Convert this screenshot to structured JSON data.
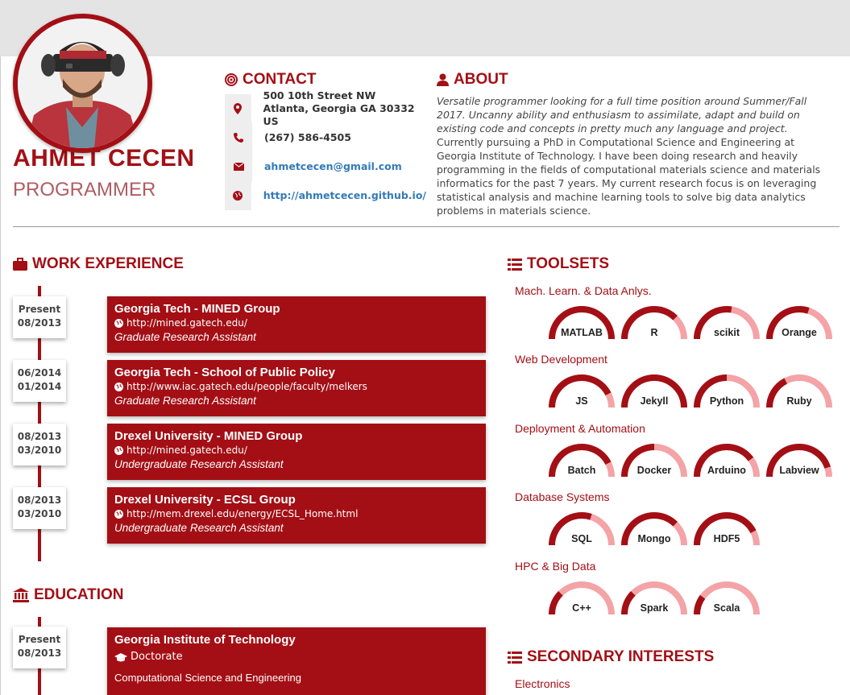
{
  "profile": {
    "name": "AHMET CECEN",
    "title": "PROGRAMMER"
  },
  "contact": {
    "heading": "CONTACT",
    "address_line1": "500 10th Street NW",
    "address_line2": "Atlanta, Georgia GA 30332 US",
    "phone": "(267) 586-4505",
    "email": "ahmetcecen@gmail.com",
    "website": "http://ahmetcecen.github.io/"
  },
  "about": {
    "heading": "ABOUT",
    "intro": "Versatile programmer looking for a full time position around Summer/Fall 2017. Uncanny ability and enthusiasm to assimilate, adapt and build on existing code and concepts in pretty much any language and project.",
    "body": "Currently pursuing a PhD in Computational Science and Engineering at Georgia Institute of Technology. I have been doing research and heavily programming in the fields of computational materials science and materials informatics for the past 7 years. My current research focus is on leveraging statistical analysis and machine learning tools to solve big data analytics problems in materials science."
  },
  "work": {
    "heading": "WORK EXPERIENCE",
    "items": [
      {
        "date_end": "Present",
        "date_start": "08/2013",
        "org": "Georgia Tech - MINED Group",
        "url": "http://mined.gatech.edu/",
        "role": "Graduate Research Assistant"
      },
      {
        "date_end": "06/2014",
        "date_start": "01/2014",
        "org": "Georgia Tech - School of Public Policy",
        "url": "http://www.iac.gatech.edu/people/faculty/melkers",
        "role": "Graduate Research Assistant"
      },
      {
        "date_end": "08/2013",
        "date_start": "03/2010",
        "org": "Drexel University - MINED Group",
        "url": "http://mined.gatech.edu/",
        "role": "Undergraduate Research Assistant"
      },
      {
        "date_end": "08/2013",
        "date_start": "03/2010",
        "org": "Drexel University - ECSL Group",
        "url": "http://mem.drexel.edu/energy/ECSL_Home.html",
        "role": "Undergraduate Research Assistant"
      }
    ]
  },
  "education": {
    "heading": "EDUCATION",
    "items": [
      {
        "date_end": "Present",
        "date_start": "08/2013",
        "school": "Georgia Institute of Technology",
        "degree": "Doctorate",
        "field": "Computational Science and Engineering"
      }
    ]
  },
  "toolsets": {
    "heading": "TOOLSETS",
    "categories": [
      {
        "name": "Mach. Learn. & Data Anlys.",
        "skills": [
          {
            "label": "MATLAB",
            "level": 1.0
          },
          {
            "label": "R",
            "level": 0.75
          },
          {
            "label": "scikit",
            "level": 0.55
          },
          {
            "label": "Orange",
            "level": 0.6
          }
        ]
      },
      {
        "name": "Web Development",
        "skills": [
          {
            "label": "JS",
            "level": 0.85
          },
          {
            "label": "Jekyll",
            "level": 1.0
          },
          {
            "label": "Python",
            "level": 0.5
          },
          {
            "label": "Ruby",
            "level": 0.35
          }
        ]
      },
      {
        "name": "Deployment & Automation",
        "skills": [
          {
            "label": "Batch",
            "level": 0.85
          },
          {
            "label": "Docker",
            "level": 0.5
          },
          {
            "label": "Arduino",
            "level": 0.8
          },
          {
            "label": "Labview",
            "level": 0.9
          }
        ]
      },
      {
        "name": "Database Systems",
        "skills": [
          {
            "label": "SQL",
            "level": 0.6
          },
          {
            "label": "Mongo",
            "level": 0.75
          },
          {
            "label": "HDF5",
            "level": 0.85
          }
        ]
      },
      {
        "name": "HPC & Big Data",
        "skills": [
          {
            "label": "C++",
            "level": 0.25
          },
          {
            "label": "Spark",
            "level": 0.25
          },
          {
            "label": "Scala",
            "level": 0.2
          }
        ]
      }
    ]
  },
  "secondary": {
    "heading": "SECONDARY INTERESTS",
    "first_category": "Electronics"
  },
  "colors": {
    "accent": "#a30f15",
    "gauge_bg": "#f4a3a6"
  }
}
